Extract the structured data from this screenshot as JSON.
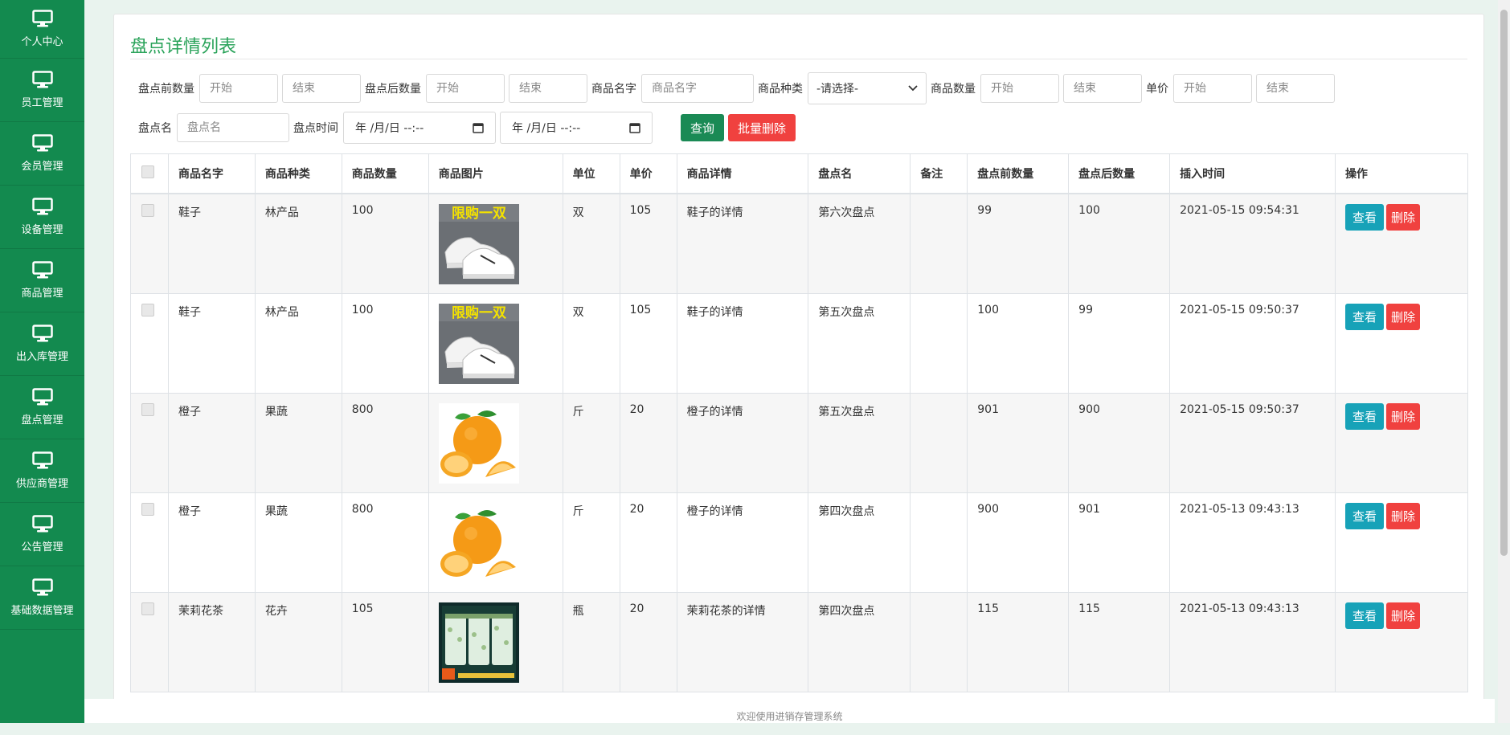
{
  "sidebar": {
    "items": [
      {
        "label": "个人中心",
        "icon": "monitor-icon"
      },
      {
        "label": "员工管理",
        "icon": "monitor-icon"
      },
      {
        "label": "会员管理",
        "icon": "monitor-icon"
      },
      {
        "label": "设备管理",
        "icon": "monitor-icon"
      },
      {
        "label": "商品管理",
        "icon": "monitor-icon"
      },
      {
        "label": "出入库管理",
        "icon": "monitor-icon"
      },
      {
        "label": "盘点管理",
        "icon": "monitor-icon"
      },
      {
        "label": "供应商管理",
        "icon": "monitor-icon"
      },
      {
        "label": "公告管理",
        "icon": "monitor-icon"
      },
      {
        "label": "基础数据管理",
        "icon": "monitor-icon"
      }
    ]
  },
  "page": {
    "title": "盘点详情列表"
  },
  "filters": {
    "before_count_label": "盘点前数量",
    "after_count_label": "盘点后数量",
    "goods_name_label": "商品名字",
    "goods_type_label": "商品种类",
    "goods_qty_label": "商品数量",
    "unit_price_label": "单价",
    "check_name_label": "盘点名",
    "check_time_label": "盘点时间",
    "start_placeholder": "开始",
    "end_placeholder": "结束",
    "goods_name_placeholder": "商品名字",
    "check_name_placeholder": "盘点名",
    "type_selected": "-请选择-",
    "date_placeholder": "年 /月/日 --:--",
    "query_button": "查询",
    "batch_delete_button": "批量删除"
  },
  "table": {
    "headers": [
      "商品名字",
      "商品种类",
      "商品数量",
      "商品图片",
      "单位",
      "单价",
      "商品详情",
      "盘点名",
      "备注",
      "盘点前数量",
      "盘点后数量",
      "插入时间",
      "操作"
    ],
    "view_label": "查看",
    "delete_label": "删除",
    "rows": [
      {
        "name": "鞋子",
        "type": "林产品",
        "qty": "100",
        "image": "shoe",
        "badge": "限购一双",
        "unit": "双",
        "price": "105",
        "detail": "鞋子的详情",
        "check": "第六次盘点",
        "note": "",
        "before": "99",
        "after": "100",
        "time": "2021-05-15 09:54:31"
      },
      {
        "name": "鞋子",
        "type": "林产品",
        "qty": "100",
        "image": "shoe",
        "badge": "限购一双",
        "unit": "双",
        "price": "105",
        "detail": "鞋子的详情",
        "check": "第五次盘点",
        "note": "",
        "before": "100",
        "after": "99",
        "time": "2021-05-15 09:50:37"
      },
      {
        "name": "橙子",
        "type": "果蔬",
        "qty": "800",
        "image": "orange",
        "badge": "",
        "unit": "斤",
        "price": "20",
        "detail": "橙子的详情",
        "check": "第五次盘点",
        "note": "",
        "before": "901",
        "after": "900",
        "time": "2021-05-15 09:50:37"
      },
      {
        "name": "橙子",
        "type": "果蔬",
        "qty": "800",
        "image": "orange",
        "badge": "",
        "unit": "斤",
        "price": "20",
        "detail": "橙子的详情",
        "check": "第四次盘点",
        "note": "",
        "before": "900",
        "after": "901",
        "time": "2021-05-13 09:43:13"
      },
      {
        "name": "茉莉花茶",
        "type": "花卉",
        "qty": "105",
        "image": "tea",
        "badge": "",
        "unit": "瓶",
        "price": "20",
        "detail": "茉莉花茶的详情",
        "check": "第四次盘点",
        "note": "",
        "before": "115",
        "after": "115",
        "time": "2021-05-13 09:43:13"
      }
    ]
  },
  "footer": {
    "text": "欢迎使用进销存管理系统"
  },
  "colors": {
    "sidebar": "#138a4f",
    "title": "#2aa35a",
    "view": "#17a2b8",
    "delete": "#f0413f",
    "query": "#1a8a55"
  }
}
